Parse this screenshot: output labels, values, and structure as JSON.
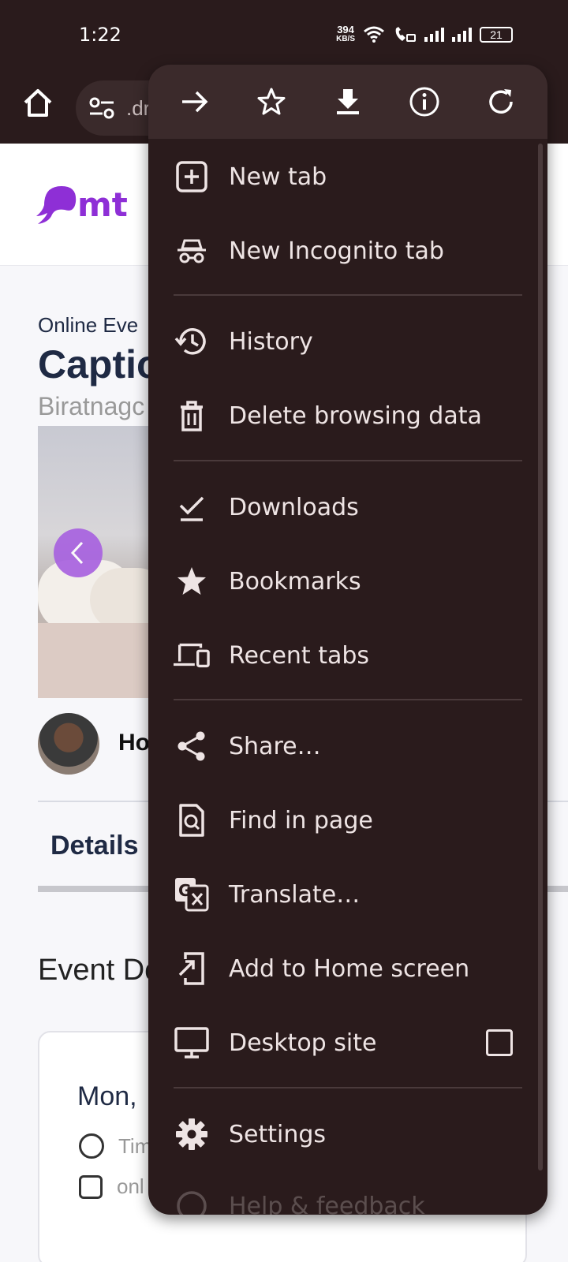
{
  "status_bar": {
    "time": "1:22",
    "speed_value": "394",
    "speed_unit": "KB/S",
    "battery": "21"
  },
  "toolbar": {
    "url_partial": ".dr"
  },
  "page": {
    "logo_text": "mt",
    "eyebrow": "Online Eve",
    "title": "Captio",
    "location": "Biratnagc",
    "host_name": "Ho",
    "tab_details": "Details",
    "section_heading": "Event Dc",
    "date_text": "Mon,",
    "time_row": "Tim",
    "online_row": "onl"
  },
  "menu": {
    "top_icons": [
      "forward-icon",
      "bookmark-star-icon",
      "download-icon",
      "info-icon",
      "reload-icon"
    ],
    "items": [
      {
        "label": "New tab",
        "icon": "new-tab-icon"
      },
      {
        "label": "New Incognito tab",
        "icon": "incognito-icon"
      },
      {
        "label": "History",
        "icon": "history-icon"
      },
      {
        "label": "Delete browsing data",
        "icon": "trash-icon"
      },
      {
        "label": "Downloads",
        "icon": "downloads-icon"
      },
      {
        "label": "Bookmarks",
        "icon": "star-icon"
      },
      {
        "label": "Recent tabs",
        "icon": "devices-icon"
      },
      {
        "label": "Share…",
        "icon": "share-icon"
      },
      {
        "label": "Find in page",
        "icon": "find-icon"
      },
      {
        "label": "Translate…",
        "icon": "translate-icon"
      },
      {
        "label": "Add to Home screen",
        "icon": "add-to-home-icon"
      },
      {
        "label": "Desktop site",
        "icon": "desktop-icon"
      },
      {
        "label": "Settings",
        "icon": "settings-icon"
      },
      {
        "label": "Help & feedback",
        "icon": "help-icon"
      }
    ],
    "desktop_site_checked": false
  },
  "colors": {
    "menu_bg": "#2a1b1c",
    "menu_top_bg": "#3b2a2b",
    "menu_text": "#eee4e4",
    "brand_purple": "#8e2fd6"
  }
}
